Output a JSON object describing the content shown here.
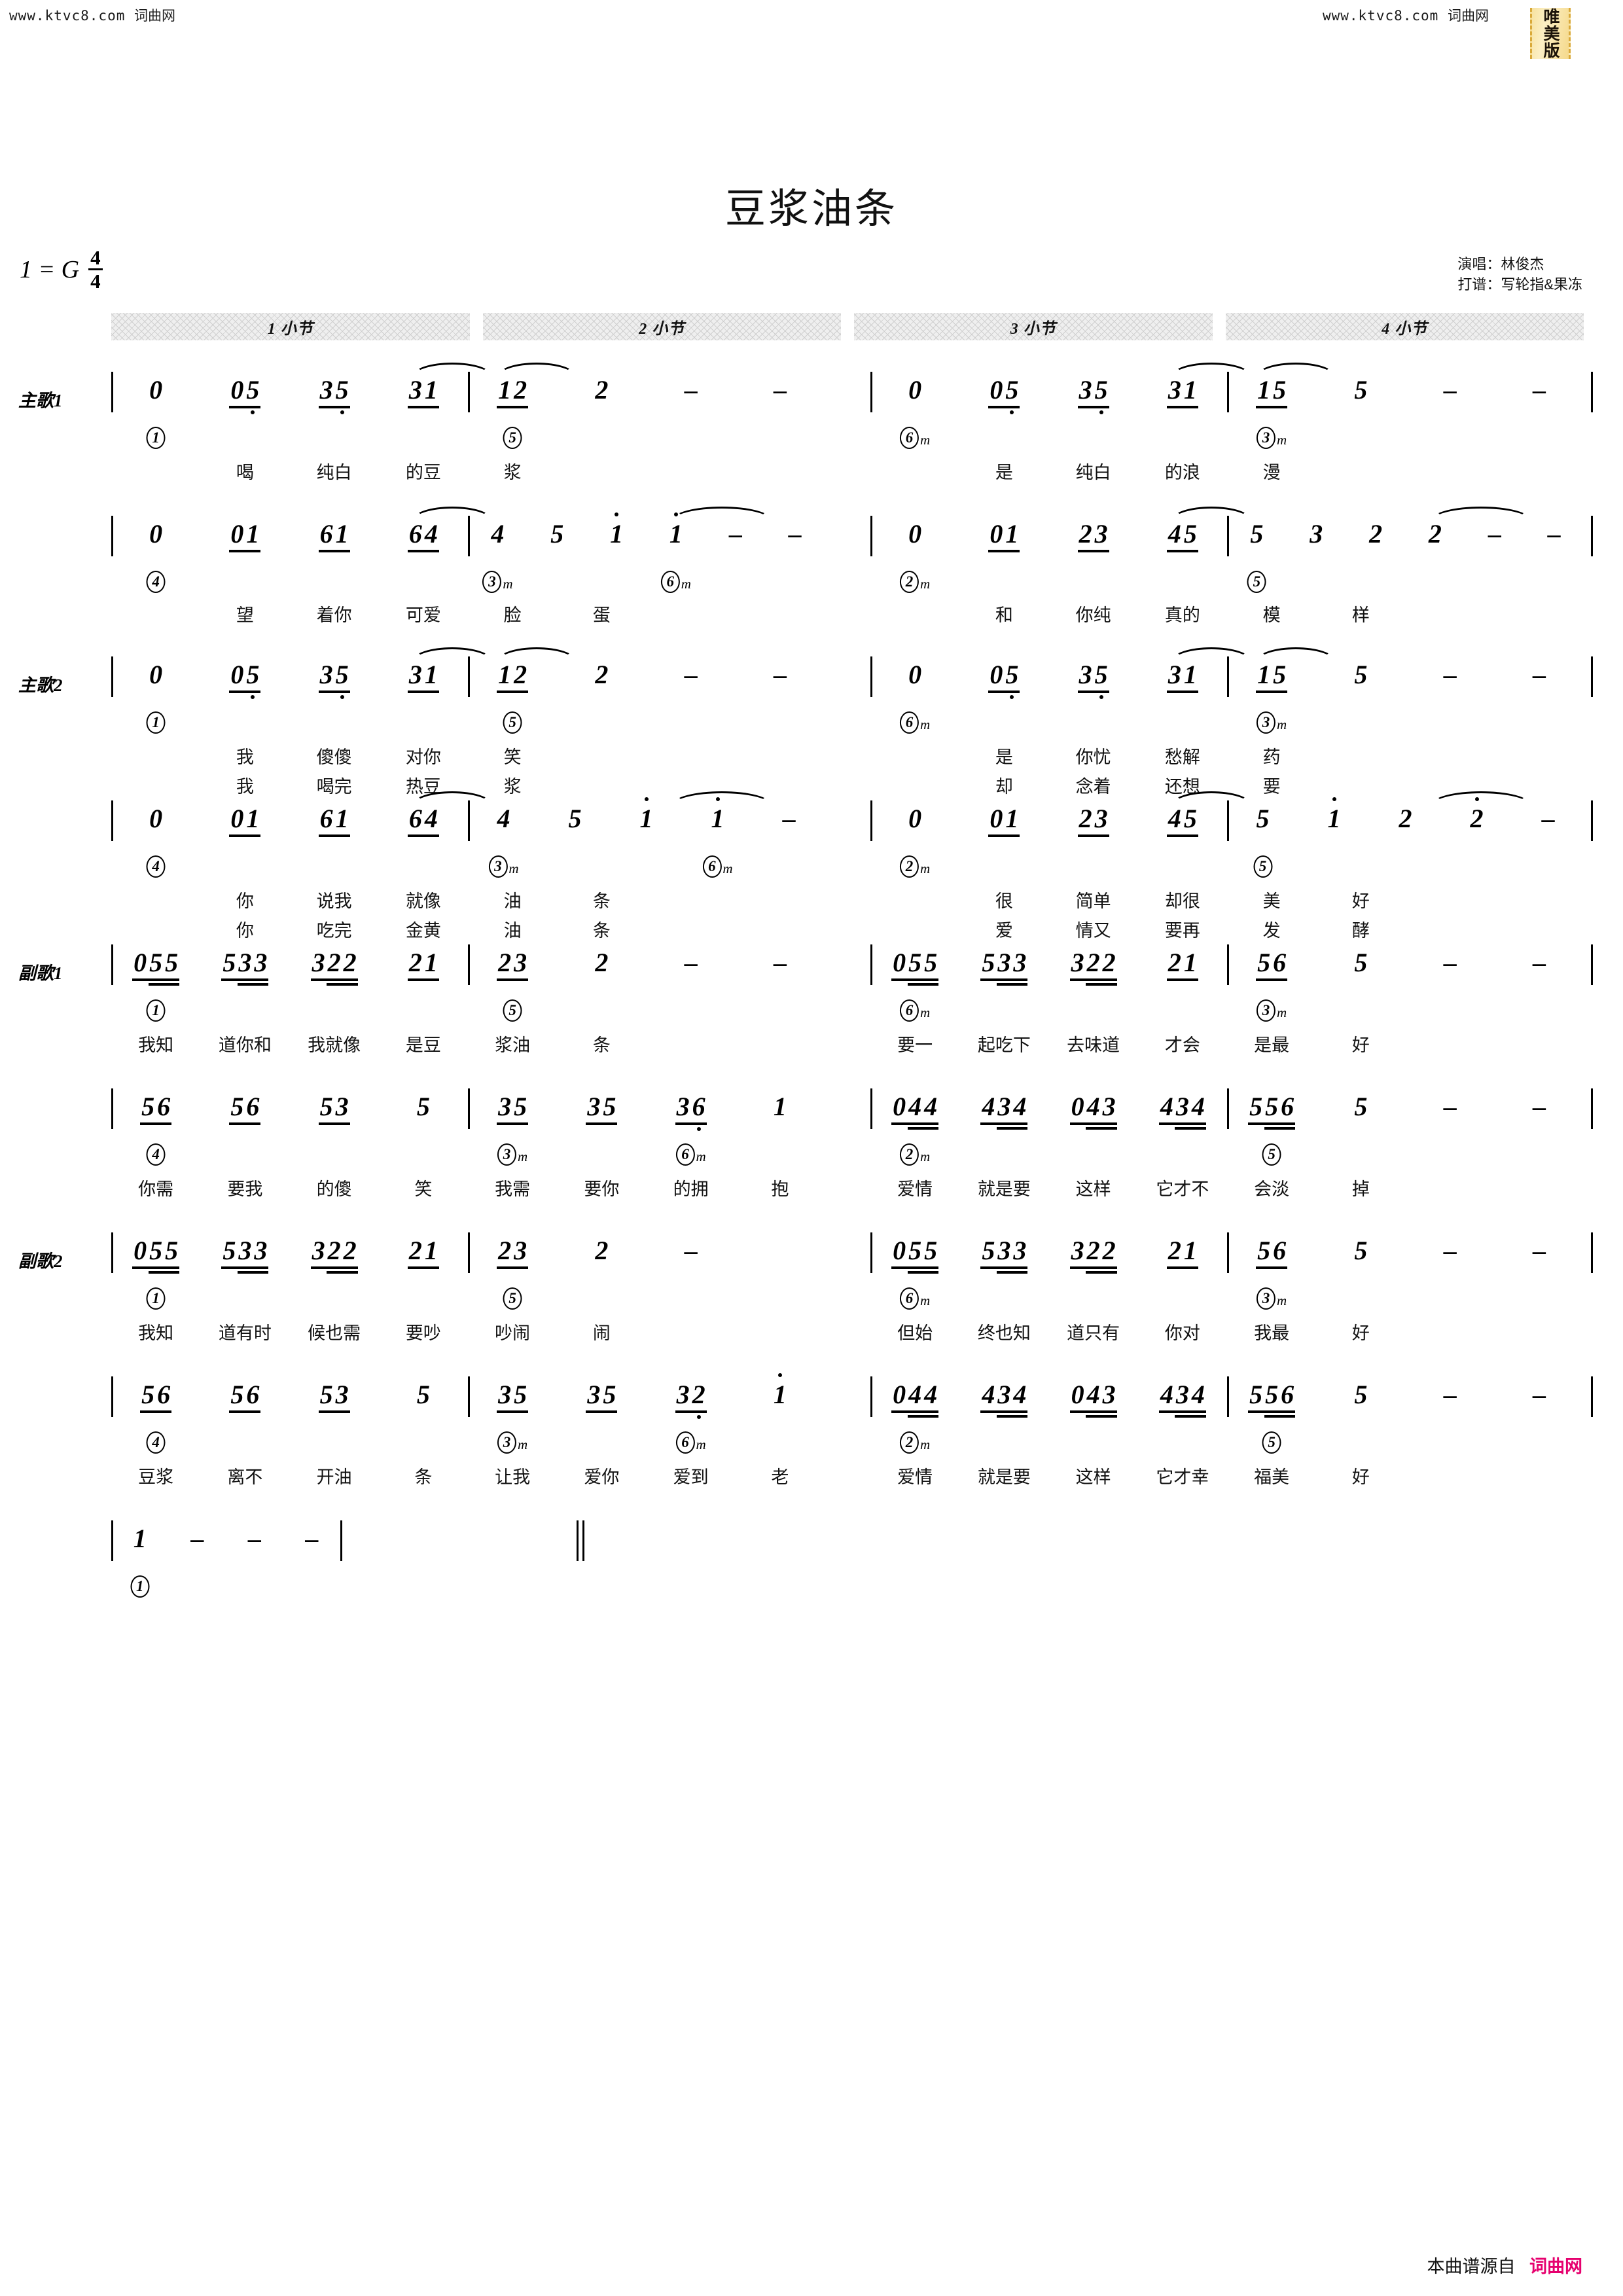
{
  "watermarks": {
    "top_left": "www.ktvc8.com",
    "top_left_cn": "词曲网",
    "top_right": "www.ktvc8.com",
    "top_right_cn": "词曲网"
  },
  "badge": {
    "text": "唯美版"
  },
  "header": {
    "title": "豆浆油条",
    "key_label": "1 = G",
    "time_num": "4",
    "time_den": "4",
    "singer_line": "演唱：林俊杰",
    "transcriber_line": "打谱：写轮指&果冻"
  },
  "measure_headers": [
    "1 小节",
    "2 小节",
    "3 小节",
    "4 小节"
  ],
  "section_labels": {
    "verse1": "主歌1",
    "verse2": "主歌2",
    "chorus1": "副歌1",
    "chorus2": "副歌2"
  },
  "systems": [
    {
      "id": "verse1-line1",
      "label": "主歌1",
      "notes_left": [
        "0",
        "05",
        "35",
        "31",
        "12",
        "2",
        "–",
        "–"
      ],
      "notes_right": [
        "0",
        "05",
        "35",
        "31",
        "15",
        "5",
        "–",
        "–"
      ],
      "chords_left": [
        "①",
        "",
        "",
        "",
        "⑤",
        "",
        "",
        ""
      ],
      "chords_right": [
        "⑥m",
        "",
        "",
        "",
        "③m",
        "",
        "",
        ""
      ],
      "lyrics_left": [
        "",
        "喝",
        "纯白",
        "的豆",
        "浆",
        "",
        "",
        ""
      ],
      "lyrics_right": [
        "",
        "是",
        "纯白",
        "的浪",
        "漫",
        "",
        "",
        ""
      ]
    },
    {
      "id": "verse1-line2",
      "label": "",
      "notes_left": [
        "0",
        "01",
        "61",
        "64",
        "4",
        "5",
        "1",
        "1",
        "–",
        "–"
      ],
      "notes_right": [
        "0",
        "01",
        "23",
        "45",
        "5",
        "3",
        "2",
        "2",
        "–",
        "–"
      ],
      "chords_left": [
        "④",
        "",
        "",
        "",
        "③m",
        "",
        "",
        "⑥m"
      ],
      "chords_right": [
        "②m",
        "",
        "",
        "",
        "⑤",
        "",
        "",
        ""
      ],
      "lyrics_left": [
        "",
        "望",
        "着你",
        "可爱",
        "脸",
        "蛋",
        "",
        ""
      ],
      "lyrics_right": [
        "",
        "和",
        "你纯",
        "真的",
        "模",
        "样",
        "",
        ""
      ]
    },
    {
      "id": "verse2-line1",
      "label": "主歌2",
      "notes_left": [
        "0",
        "05",
        "35",
        "31",
        "12",
        "2",
        "–",
        "–"
      ],
      "notes_right": [
        "0",
        "05",
        "35",
        "31",
        "15",
        "5",
        "–",
        "–"
      ],
      "chords_left": [
        "①",
        "",
        "",
        "",
        "⑤",
        "",
        "",
        ""
      ],
      "chords_right": [
        "⑥m",
        "",
        "",
        "",
        "③m",
        "",
        "",
        ""
      ],
      "lyrics_left": [
        "",
        "我",
        "傻傻",
        "对你",
        "笑",
        "",
        "",
        ""
      ],
      "lyrics_left2": [
        "",
        "我",
        "喝完",
        "热豆",
        "浆",
        "",
        "",
        ""
      ],
      "lyrics_right": [
        "",
        "是",
        "你忧",
        "愁解",
        "药",
        "",
        "",
        ""
      ],
      "lyrics_right2": [
        "",
        "却",
        "念着",
        "还想",
        "要",
        "",
        "",
        ""
      ]
    },
    {
      "id": "verse2-line2",
      "label": "",
      "notes_left": [
        "0",
        "01",
        "61",
        "64",
        "4",
        "5",
        "1",
        "1",
        "–"
      ],
      "notes_right": [
        "0",
        "01",
        "23",
        "45",
        "5",
        "1",
        "2",
        "2",
        "–"
      ],
      "chords_left": [
        "④",
        "",
        "",
        "",
        "③m",
        "",
        "",
        "⑥m"
      ],
      "chords_right": [
        "②m",
        "",
        "",
        "",
        "⑤",
        "",
        "",
        ""
      ],
      "lyrics_left": [
        "",
        "你",
        "说我",
        "就像",
        "油",
        "条",
        "",
        ""
      ],
      "lyrics_left2": [
        "",
        "你",
        "吃完",
        "金黄",
        "油",
        "条",
        "",
        ""
      ],
      "lyrics_right": [
        "",
        "很",
        "简单",
        "却很",
        "美",
        "好",
        "",
        ""
      ],
      "lyrics_right2": [
        "",
        "爱",
        "情又",
        "要再",
        "发",
        "酵",
        "",
        ""
      ]
    },
    {
      "id": "chorus1-line1",
      "label": "副歌1",
      "notes_left": [
        "055",
        "533",
        "322",
        "21",
        "23",
        "2",
        "–",
        "–"
      ],
      "notes_right": [
        "055",
        "533",
        "322",
        "21",
        "56",
        "5",
        "–",
        "–"
      ],
      "chords_left": [
        "①",
        "",
        "",
        "",
        "⑤",
        "",
        "",
        ""
      ],
      "chords_right": [
        "⑥m",
        "",
        "",
        "",
        "③m",
        "",
        "",
        ""
      ],
      "lyrics_left": [
        "我知",
        "道你和",
        "我就像",
        "是豆",
        "浆油",
        "条",
        "",
        ""
      ],
      "lyrics_right": [
        "要一",
        "起吃下",
        "去味道",
        "才会",
        "是最",
        "好",
        "",
        ""
      ]
    },
    {
      "id": "chorus1-line2",
      "label": "",
      "notes_left": [
        "56",
        "56",
        "53",
        "5",
        "35",
        "35",
        "36",
        "1"
      ],
      "notes_right": [
        "044",
        "434",
        "043",
        "434",
        "556",
        "5",
        "–",
        "–"
      ],
      "chords_left": [
        "④",
        "",
        "",
        "",
        "③m",
        "",
        "⑥m",
        ""
      ],
      "chords_right": [
        "②m",
        "",
        "",
        "",
        "⑤",
        "",
        "",
        ""
      ],
      "lyrics_left": [
        "你需",
        "要我",
        "的傻",
        "笑",
        "我需",
        "要你",
        "的拥",
        "抱"
      ],
      "lyrics_right": [
        "爱情",
        "就是要",
        "这样",
        "它才不",
        "会淡",
        "掉",
        "",
        ""
      ]
    },
    {
      "id": "chorus2-line1",
      "label": "副歌2",
      "notes_left": [
        "055",
        "533",
        "322",
        "21",
        "23",
        "2",
        "–",
        ""
      ],
      "notes_right": [
        "055",
        "533",
        "322",
        "21",
        "56",
        "5",
        "–",
        "–"
      ],
      "chords_left": [
        "①",
        "",
        "",
        "",
        "⑤",
        "",
        "",
        ""
      ],
      "chords_right": [
        "⑥m",
        "",
        "",
        "",
        "③m",
        "",
        "",
        ""
      ],
      "lyrics_left": [
        "我知",
        "道有时",
        "候也需",
        "要吵",
        "吵闹",
        "闹",
        "",
        ""
      ],
      "lyrics_right": [
        "但始",
        "终也知",
        "道只有",
        "你对",
        "我最",
        "好",
        "",
        ""
      ]
    },
    {
      "id": "chorus2-line2",
      "label": "",
      "notes_left": [
        "56",
        "56",
        "53",
        "5",
        "35",
        "35",
        "32",
        "1"
      ],
      "notes_right": [
        "044",
        "434",
        "043",
        "434",
        "556",
        "5",
        "–",
        "–"
      ],
      "chords_left": [
        "④",
        "",
        "",
        "",
        "③m",
        "",
        "⑥m",
        ""
      ],
      "chords_right": [
        "②m",
        "",
        "",
        "",
        "⑤",
        "",
        "",
        ""
      ],
      "lyrics_left": [
        "豆浆",
        "离不",
        "开油",
        "条",
        "让我",
        "爱你",
        "爱到",
        "老"
      ],
      "lyrics_right": [
        "爱情",
        "就是要",
        "这样",
        "它才幸",
        "福美",
        "好",
        "",
        ""
      ]
    },
    {
      "id": "ending",
      "label": "",
      "notes_left": [
        "1",
        "–",
        "–",
        "–"
      ],
      "chords_left": [
        "①",
        "",
        "",
        ""
      ],
      "lyrics_left": [
        "",
        "",
        "",
        ""
      ]
    }
  ],
  "footer": {
    "text": "本曲谱源自",
    "site": "词曲网"
  }
}
